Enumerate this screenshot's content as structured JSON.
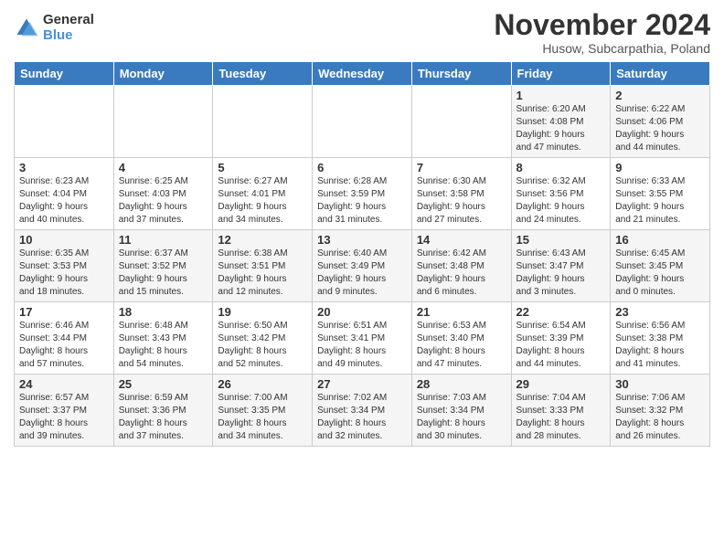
{
  "logo": {
    "general": "General",
    "blue": "Blue"
  },
  "title": "November 2024",
  "location": "Husow, Subcarpathia, Poland",
  "days_of_week": [
    "Sunday",
    "Monday",
    "Tuesday",
    "Wednesday",
    "Thursday",
    "Friday",
    "Saturday"
  ],
  "weeks": [
    [
      {
        "day": "",
        "info": ""
      },
      {
        "day": "",
        "info": ""
      },
      {
        "day": "",
        "info": ""
      },
      {
        "day": "",
        "info": ""
      },
      {
        "day": "",
        "info": ""
      },
      {
        "day": "1",
        "info": "Sunrise: 6:20 AM\nSunset: 4:08 PM\nDaylight: 9 hours\nand 47 minutes."
      },
      {
        "day": "2",
        "info": "Sunrise: 6:22 AM\nSunset: 4:06 PM\nDaylight: 9 hours\nand 44 minutes."
      }
    ],
    [
      {
        "day": "3",
        "info": "Sunrise: 6:23 AM\nSunset: 4:04 PM\nDaylight: 9 hours\nand 40 minutes."
      },
      {
        "day": "4",
        "info": "Sunrise: 6:25 AM\nSunset: 4:03 PM\nDaylight: 9 hours\nand 37 minutes."
      },
      {
        "day": "5",
        "info": "Sunrise: 6:27 AM\nSunset: 4:01 PM\nDaylight: 9 hours\nand 34 minutes."
      },
      {
        "day": "6",
        "info": "Sunrise: 6:28 AM\nSunset: 3:59 PM\nDaylight: 9 hours\nand 31 minutes."
      },
      {
        "day": "7",
        "info": "Sunrise: 6:30 AM\nSunset: 3:58 PM\nDaylight: 9 hours\nand 27 minutes."
      },
      {
        "day": "8",
        "info": "Sunrise: 6:32 AM\nSunset: 3:56 PM\nDaylight: 9 hours\nand 24 minutes."
      },
      {
        "day": "9",
        "info": "Sunrise: 6:33 AM\nSunset: 3:55 PM\nDaylight: 9 hours\nand 21 minutes."
      }
    ],
    [
      {
        "day": "10",
        "info": "Sunrise: 6:35 AM\nSunset: 3:53 PM\nDaylight: 9 hours\nand 18 minutes."
      },
      {
        "day": "11",
        "info": "Sunrise: 6:37 AM\nSunset: 3:52 PM\nDaylight: 9 hours\nand 15 minutes."
      },
      {
        "day": "12",
        "info": "Sunrise: 6:38 AM\nSunset: 3:51 PM\nDaylight: 9 hours\nand 12 minutes."
      },
      {
        "day": "13",
        "info": "Sunrise: 6:40 AM\nSunset: 3:49 PM\nDaylight: 9 hours\nand 9 minutes."
      },
      {
        "day": "14",
        "info": "Sunrise: 6:42 AM\nSunset: 3:48 PM\nDaylight: 9 hours\nand 6 minutes."
      },
      {
        "day": "15",
        "info": "Sunrise: 6:43 AM\nSunset: 3:47 PM\nDaylight: 9 hours\nand 3 minutes."
      },
      {
        "day": "16",
        "info": "Sunrise: 6:45 AM\nSunset: 3:45 PM\nDaylight: 9 hours\nand 0 minutes."
      }
    ],
    [
      {
        "day": "17",
        "info": "Sunrise: 6:46 AM\nSunset: 3:44 PM\nDaylight: 8 hours\nand 57 minutes."
      },
      {
        "day": "18",
        "info": "Sunrise: 6:48 AM\nSunset: 3:43 PM\nDaylight: 8 hours\nand 54 minutes."
      },
      {
        "day": "19",
        "info": "Sunrise: 6:50 AM\nSunset: 3:42 PM\nDaylight: 8 hours\nand 52 minutes."
      },
      {
        "day": "20",
        "info": "Sunrise: 6:51 AM\nSunset: 3:41 PM\nDaylight: 8 hours\nand 49 minutes."
      },
      {
        "day": "21",
        "info": "Sunrise: 6:53 AM\nSunset: 3:40 PM\nDaylight: 8 hours\nand 47 minutes."
      },
      {
        "day": "22",
        "info": "Sunrise: 6:54 AM\nSunset: 3:39 PM\nDaylight: 8 hours\nand 44 minutes."
      },
      {
        "day": "23",
        "info": "Sunrise: 6:56 AM\nSunset: 3:38 PM\nDaylight: 8 hours\nand 41 minutes."
      }
    ],
    [
      {
        "day": "24",
        "info": "Sunrise: 6:57 AM\nSunset: 3:37 PM\nDaylight: 8 hours\nand 39 minutes."
      },
      {
        "day": "25",
        "info": "Sunrise: 6:59 AM\nSunset: 3:36 PM\nDaylight: 8 hours\nand 37 minutes."
      },
      {
        "day": "26",
        "info": "Sunrise: 7:00 AM\nSunset: 3:35 PM\nDaylight: 8 hours\nand 34 minutes."
      },
      {
        "day": "27",
        "info": "Sunrise: 7:02 AM\nSunset: 3:34 PM\nDaylight: 8 hours\nand 32 minutes."
      },
      {
        "day": "28",
        "info": "Sunrise: 7:03 AM\nSunset: 3:34 PM\nDaylight: 8 hours\nand 30 minutes."
      },
      {
        "day": "29",
        "info": "Sunrise: 7:04 AM\nSunset: 3:33 PM\nDaylight: 8 hours\nand 28 minutes."
      },
      {
        "day": "30",
        "info": "Sunrise: 7:06 AM\nSunset: 3:32 PM\nDaylight: 8 hours\nand 26 minutes."
      }
    ]
  ]
}
